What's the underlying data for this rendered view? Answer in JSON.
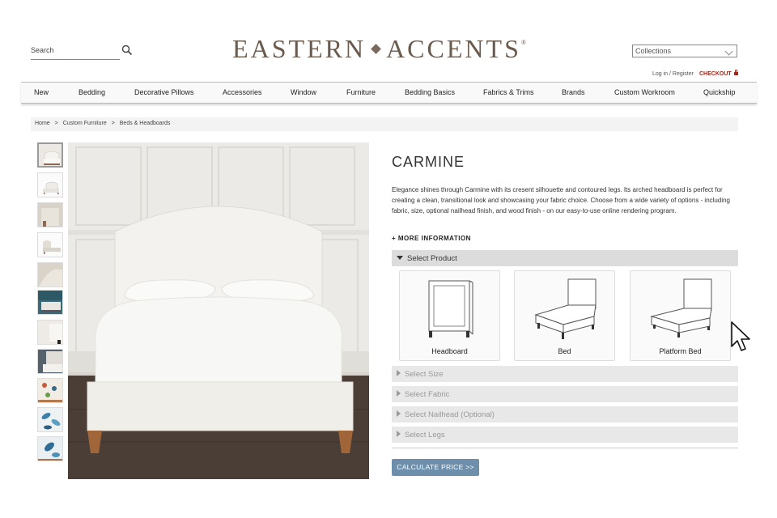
{
  "header": {
    "search_label": "Search",
    "logo_left": "EASTERN",
    "logo_right": "ACCENTS",
    "logo_reg": "®",
    "collections_label": "Collections",
    "account_link": "Log in / Register",
    "checkout_label": "CHECKOUT"
  },
  "nav": {
    "items": [
      "New",
      "Bedding",
      "Decorative Pillows",
      "Accessories",
      "Window",
      "Furniture",
      "Bedding Basics",
      "Fabrics & Trims",
      "Brands",
      "Custom Workroom",
      "Quickship"
    ]
  },
  "breadcrumb": {
    "items": [
      "Home",
      ">",
      "Custom Furniture",
      ">",
      "Beds & Headboards"
    ]
  },
  "product": {
    "title": "CARMINE",
    "description": "Elegance shines through Carmine with its cresent silhouette and contoured legs. Its arched headboard is perfect for creating a clean, transitional look and showcasing your fabric choice. Choose from a wide variety of options - including fabric, size, optional nailhead finish, and wood finish - on our easy-to-use online rendering program.",
    "more_info": "+ MORE INFORMATION"
  },
  "configurator": {
    "sections": [
      "Select Product",
      "Select Size",
      "Select Fabric",
      "Select Nailhead (Optional)",
      "Select Legs"
    ],
    "product_options": [
      "Headboard",
      "Bed",
      "Platform Bed"
    ],
    "calculate_label": "CALCULATE PRICE >>"
  },
  "thumbnails": {
    "count": 11,
    "selected_index": 0
  },
  "icons": [
    "search-icon",
    "chevron-down-icon",
    "lock-icon",
    "caret-down-icon",
    "caret-right-icon",
    "pointer-cursor-icon"
  ],
  "colors": {
    "logo": "#6b5a4e",
    "checkout": "#a3281c",
    "button": "#6d8fab",
    "accordion": "#e8e8e8"
  }
}
